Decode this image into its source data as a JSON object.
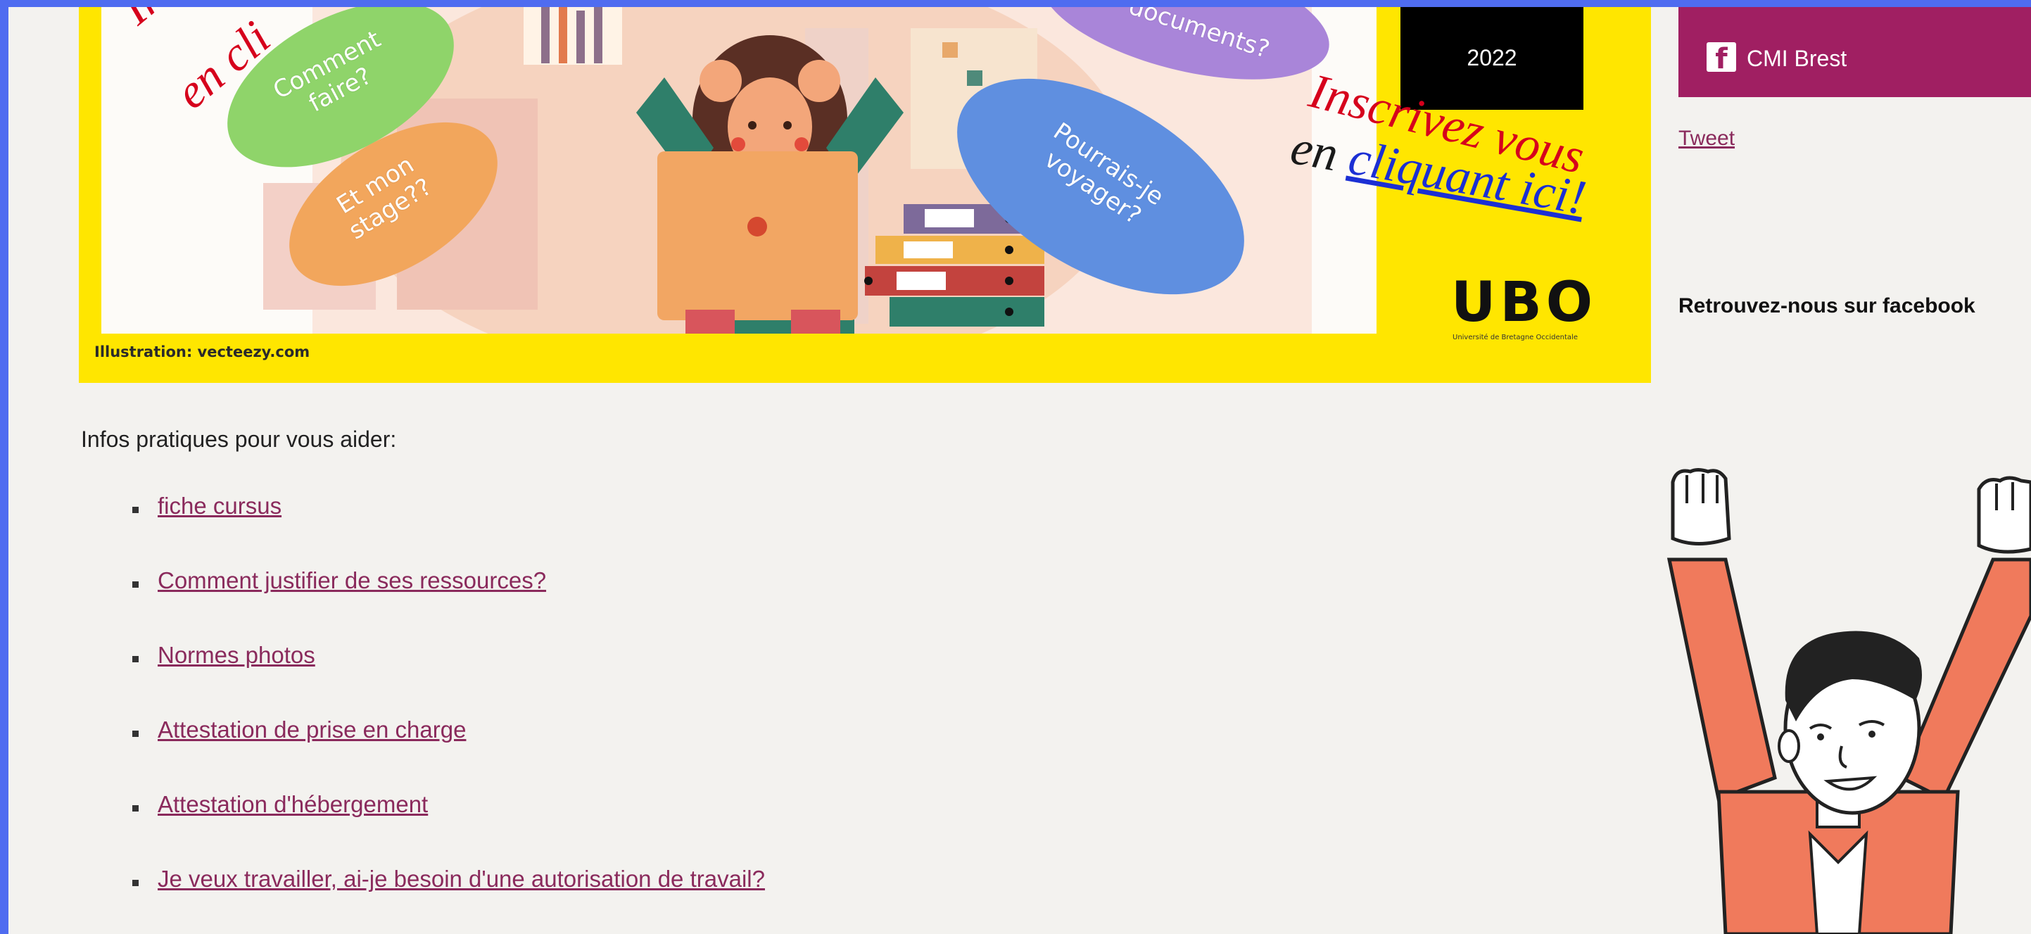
{
  "banner": {
    "bubbles": {
      "comment_faire": "Comment faire?",
      "et_mon_stage": "Et mon stage??",
      "pourrais_je_voyager": "Pourrais-je voyager?",
      "documents": "documents?"
    },
    "cta_left_line1": "Ins",
    "cta_left_line2": "en cli",
    "year": "2022",
    "cta_line1": "Inscrivez vous",
    "cta_line2_prefix": "en",
    "cta_line2_link": "cliquant ici!",
    "logo": "UBO",
    "logo_subtitle": "Université de Bretagne Occidentale",
    "credit": "Illustration: vecteezy.com"
  },
  "sidebar": {
    "facebook_button": "CMI Brest",
    "tweet_link": "Tweet",
    "facebook_heading": "Retrouvez-nous sur facebook"
  },
  "content": {
    "intro": "Infos pratiques pour vous aider:",
    "links": [
      "fiche cursus",
      "Comment justifier de ses ressources?",
      "Normes photos",
      "Attestation de prise en charge",
      "Attestation d'hébergement",
      "Je veux travailler, ai-je besoin d'une autorisation de travail?"
    ]
  },
  "colors": {
    "frame": "#4f6cf0",
    "page_background": "#f3f2ef",
    "facebook_bar": "#a01f62",
    "link": "#8a2a5c",
    "banner_yellow": "#ffe600"
  },
  "icons": [
    "facebook-icon"
  ]
}
